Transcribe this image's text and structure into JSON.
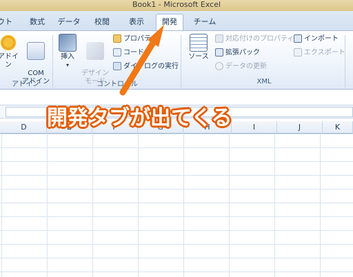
{
  "window": {
    "title": "Book1  -  Microsoft Excel"
  },
  "tabs": [
    {
      "label": "ウト"
    },
    {
      "label": "数式"
    },
    {
      "label": "データ"
    },
    {
      "label": "校閲"
    },
    {
      "label": "表示"
    },
    {
      "label": "開発",
      "active": true
    },
    {
      "label": "チーム"
    }
  ],
  "ribbon": {
    "addins_group": {
      "label": "アドイン",
      "buttons": [
        {
          "label": "アドイン"
        },
        {
          "label": "COM\nアドイン"
        }
      ]
    },
    "controls_group": {
      "label": "コントロール",
      "insert_label": "挿入",
      "design_mode_label": "デザイン\nモード",
      "properties_label": "プロパティ",
      "view_code_label": "コードの",
      "run_dialog_label": "ダイアログの実行"
    },
    "xml_group": {
      "label": "XML",
      "source_label": "ソース",
      "map_properties_label": "対応付けのプロパティ",
      "expansion_pack_label": "拡張パック",
      "refresh_data_label": "データの更新",
      "import_label": "インポート",
      "export_label": "エクスポート"
    }
  },
  "grid": {
    "columns": [
      "D",
      "E",
      "F",
      "G",
      "H",
      "I",
      "J",
      "K"
    ]
  },
  "annotation": {
    "text": "開発タブが出てくる",
    "color": "#e35d00"
  }
}
